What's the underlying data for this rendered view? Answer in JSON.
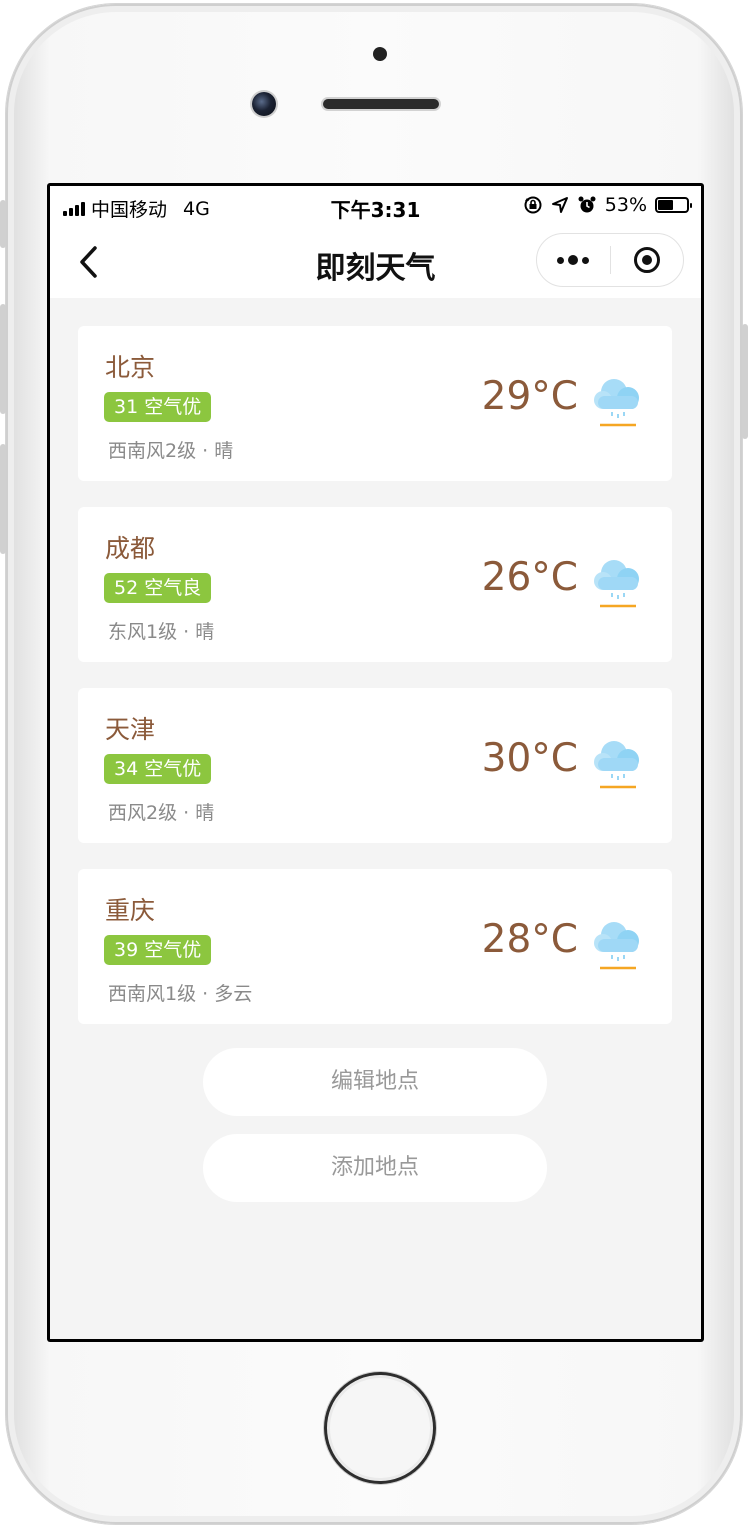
{
  "status_bar": {
    "carrier": "中国移动",
    "network": "4G",
    "time": "下午3:31",
    "battery": "53%"
  },
  "nav": {
    "title": "即刻天气"
  },
  "cities": [
    {
      "name": "北京",
      "aqi": "31 空气优",
      "wind_weather": "西南风2级 · 晴",
      "temperature": "29°C",
      "icon": "cloud-rain-icon"
    },
    {
      "name": "成都",
      "aqi": "52 空气良",
      "wind_weather": "东风1级 · 晴",
      "temperature": "26°C",
      "icon": "cloud-rain-icon"
    },
    {
      "name": "天津",
      "aqi": "34 空气优",
      "wind_weather": "西风2级 · 晴",
      "temperature": "30°C",
      "icon": "cloud-rain-icon"
    },
    {
      "name": "重庆",
      "aqi": "39 空气优",
      "wind_weather": "西南风1级 · 多云",
      "temperature": "28°C",
      "icon": "cloud-rain-icon"
    }
  ],
  "actions": {
    "edit": "编辑地点",
    "add": "添加地点"
  },
  "colors": {
    "city_text": "#8b5a3a",
    "aqi_badge": "#8cc63f",
    "background": "#f4f4f4",
    "cloud": "#8fd3f4",
    "sun_line": "#f5a623"
  }
}
